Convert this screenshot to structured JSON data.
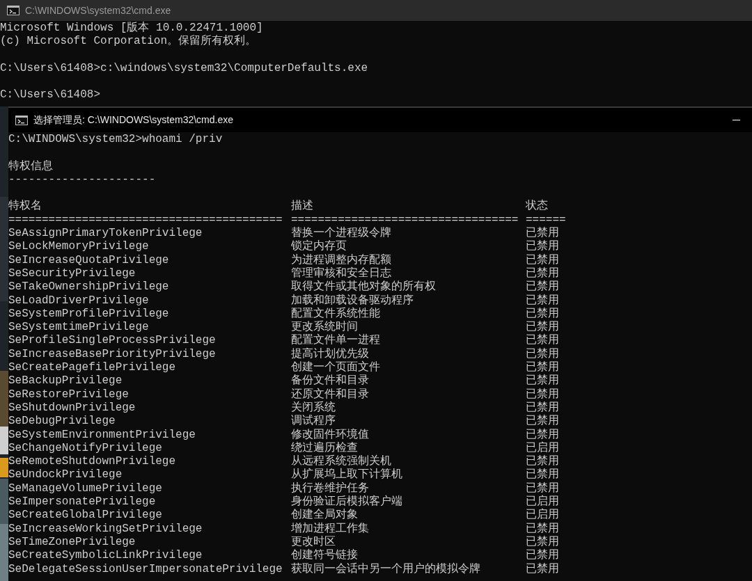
{
  "back_window": {
    "title": "C:\\WINDOWS\\system32\\cmd.exe",
    "output_blocks": [
      [
        "Microsoft Windows [版本 10.0.22471.1000]",
        "(c) Microsoft Corporation。保留所有权利。"
      ],
      [
        "C:\\Users\\61408>c:\\windows\\system32\\ComputerDefaults.exe"
      ],
      [
        "C:\\Users\\61408>"
      ]
    ]
  },
  "front_window": {
    "title": "选择管理员: C:\\WINDOWS\\system32\\cmd.exe",
    "command_line": "C:\\WINDOWS\\system32>whoami /priv",
    "section_title": "特权信息",
    "section_rule": "----------------------",
    "columns": [
      "特权名",
      "描述",
      "状态"
    ],
    "column_rules": [
      "=========================================",
      "==================================",
      "======"
    ],
    "rows": [
      {
        "name": "SeAssignPrimaryTokenPrivilege",
        "description": "替换一个进程级令牌",
        "status": "已禁用"
      },
      {
        "name": "SeLockMemoryPrivilege",
        "description": "锁定内存页",
        "status": "已禁用"
      },
      {
        "name": "SeIncreaseQuotaPrivilege",
        "description": "为进程调整内存配额",
        "status": "已禁用"
      },
      {
        "name": "SeSecurityPrivilege",
        "description": "管理审核和安全日志",
        "status": "已禁用"
      },
      {
        "name": "SeTakeOwnershipPrivilege",
        "description": "取得文件或其他对象的所有权",
        "status": "已禁用"
      },
      {
        "name": "SeLoadDriverPrivilege",
        "description": "加载和卸载设备驱动程序",
        "status": "已禁用"
      },
      {
        "name": "SeSystemProfilePrivilege",
        "description": "配置文件系统性能",
        "status": "已禁用"
      },
      {
        "name": "SeSystemtimePrivilege",
        "description": "更改系统时间",
        "status": "已禁用"
      },
      {
        "name": "SeProfileSingleProcessPrivilege",
        "description": "配置文件单一进程",
        "status": "已禁用"
      },
      {
        "name": "SeIncreaseBasePriorityPrivilege",
        "description": "提高计划优先级",
        "status": "已禁用"
      },
      {
        "name": "SeCreatePagefilePrivilege",
        "description": "创建一个页面文件",
        "status": "已禁用"
      },
      {
        "name": "SeBackupPrivilege",
        "description": "备份文件和目录",
        "status": "已禁用"
      },
      {
        "name": "SeRestorePrivilege",
        "description": "还原文件和目录",
        "status": "已禁用"
      },
      {
        "name": "SeShutdownPrivilege",
        "description": "关闭系统",
        "status": "已禁用"
      },
      {
        "name": "SeDebugPrivilege",
        "description": "调试程序",
        "status": "已禁用"
      },
      {
        "name": "SeSystemEnvironmentPrivilege",
        "description": "修改固件环境值",
        "status": "已禁用"
      },
      {
        "name": "SeChangeNotifyPrivilege",
        "description": "绕过遍历检查",
        "status": "已启用"
      },
      {
        "name": "SeRemoteShutdownPrivilege",
        "description": "从远程系统强制关机",
        "status": "已禁用"
      },
      {
        "name": "SeUndockPrivilege",
        "description": "从扩展坞上取下计算机",
        "status": "已禁用"
      },
      {
        "name": "SeManageVolumePrivilege",
        "description": "执行卷维护任务",
        "status": "已禁用"
      },
      {
        "name": "SeImpersonatePrivilege",
        "description": "身份验证后模拟客户端",
        "status": "已启用"
      },
      {
        "name": "SeCreateGlobalPrivilege",
        "description": "创建全局对象",
        "status": "已启用"
      },
      {
        "name": "SeIncreaseWorkingSetPrivilege",
        "description": "增加进程工作集",
        "status": "已禁用"
      },
      {
        "name": "SeTimeZonePrivilege",
        "description": "更改时区",
        "status": "已禁用"
      },
      {
        "name": "SeCreateSymbolicLinkPrivilege",
        "description": "创建符号链接",
        "status": "已禁用"
      },
      {
        "name": "SeDelegateSessionUserImpersonatePrivilege",
        "description": "获取同一会话中另一个用户的模拟令牌",
        "status": "已禁用"
      }
    ]
  }
}
